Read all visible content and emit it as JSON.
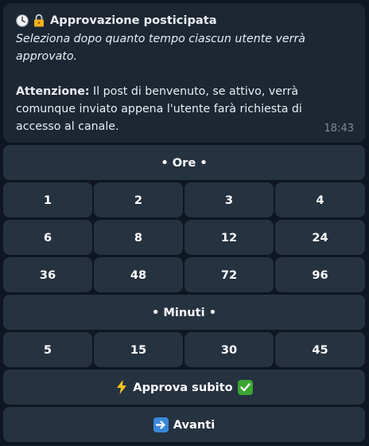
{
  "message": {
    "title": "Approvazione posticipata",
    "subtitle_line1": "Seleziona dopo quanto tempo ciascun utente verrà",
    "subtitle_line2": "approvato.",
    "warning_label": "Attenzione:",
    "warning_text_line1": " Il post di benvenuto, se attivo, verrà",
    "warning_text_line2": "comunque inviato appena l'utente farà richiesta di",
    "warning_text_line3": "accesso al canale.",
    "time": "18:43",
    "icons": [
      "clock-icon",
      "lock-icon"
    ]
  },
  "keyboard": {
    "hours_header": "• Ore •",
    "hours_row1": [
      "1",
      "2",
      "3",
      "4"
    ],
    "hours_row2": [
      "6",
      "8",
      "12",
      "24"
    ],
    "hours_row3": [
      "36",
      "48",
      "72",
      "96"
    ],
    "minutes_header": "• Minuti •",
    "minutes_row": [
      "5",
      "15",
      "30",
      "45"
    ],
    "approve_now": "Approva subito",
    "next": "Avanti"
  },
  "colors": {
    "background": "#0e1621",
    "bubble": "#1d2733",
    "button": "#253240",
    "text": "#e9eef3",
    "time": "#7b8a99"
  }
}
